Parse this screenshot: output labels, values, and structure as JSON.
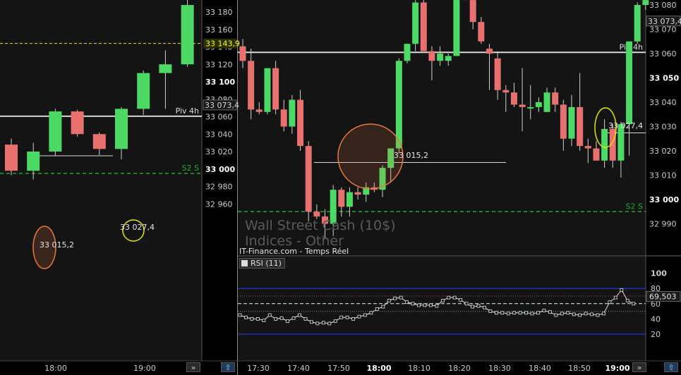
{
  "chart_data": [
    {
      "type": "candlestick",
      "ylim": [
        32950,
        33190
      ],
      "y_ticks": [
        "33 180",
        "33 160",
        "33 140",
        "33 120",
        "33 100",
        "33 080",
        "33 060",
        "33 040",
        "33 020",
        "33 000",
        "32 980",
        "32 960"
      ],
      "y_ticks_bold": [
        "33 100",
        "33 000"
      ],
      "x_ticks": [
        "18:00",
        "19:00"
      ],
      "candles": [
        {
          "o": 33028,
          "h": 33035,
          "l": 32993,
          "c": 32998
        },
        {
          "o": 32998,
          "h": 33030,
          "l": 32988,
          "c": 33020
        },
        {
          "o": 33020,
          "h": 33069,
          "l": 33015,
          "c": 33066
        },
        {
          "o": 33066,
          "h": 33068,
          "l": 33037,
          "c": 33040
        },
        {
          "o": 33040,
          "h": 33042,
          "l": 33016,
          "c": 33023
        },
        {
          "o": 33023,
          "h": 33071,
          "l": 33011,
          "c": 33069
        },
        {
          "o": 33069,
          "h": 33113,
          "l": 33062,
          "c": 33110
        },
        {
          "o": 33110,
          "h": 33136,
          "l": 33069,
          "c": 33120
        },
        {
          "o": 33120,
          "h": 33198,
          "l": 33117,
          "c": 33188
        }
      ],
      "levels": [
        {
          "label": "Piv 4h",
          "value": 33060.5,
          "color": "#d8d8d8",
          "style": "solid"
        },
        {
          "label": "",
          "value": 33143.9,
          "color": "#e6e600",
          "style": "dash"
        },
        {
          "label": "S2 S",
          "value": 32995,
          "color": "#1faa2f",
          "style": "dash"
        },
        {
          "label": "33 015,2",
          "value": 33015.2,
          "color": "#d8d8d8",
          "style": "solid"
        }
      ],
      "price_tags": [
        {
          "text": "33 143,9",
          "color": "#ffff00",
          "bg": "#2b2b00"
        },
        {
          "text": "33 073,4",
          "color": "#d8d8d8",
          "bg": "#1a1a1a"
        }
      ],
      "annotations": [
        {
          "text": "33 015,2",
          "color": "#e6e6e6"
        },
        {
          "text": "33 027,4",
          "color": "#e6e6e6"
        }
      ]
    },
    {
      "type": "candlestick",
      "ylim": [
        32978,
        33086
      ],
      "y_ticks": [
        "33 080",
        "33 070",
        "33 060",
        "33 050",
        "33 040",
        "33 030",
        "33 020",
        "33 010",
        "33 000",
        "32 990"
      ],
      "y_ticks_bold": [
        "33 050",
        "33 000"
      ],
      "x_ticks": [
        "17:30",
        "17:40",
        "17:50",
        "18:00",
        "18:10",
        "18:20",
        "18:30",
        "18:40",
        "18:50",
        "19:00"
      ],
      "x_ticks_bold": [
        "18:00",
        "19:00"
      ],
      "candles": [
        {
          "o": 33063,
          "h": 33066,
          "l": 33054,
          "c": 33057
        },
        {
          "o": 33057,
          "h": 33062,
          "l": 33033,
          "c": 33037
        },
        {
          "o": 33037,
          "h": 33040,
          "l": 33035,
          "c": 33036
        },
        {
          "o": 33036,
          "h": 33054,
          "l": 33035,
          "c": 33054
        },
        {
          "o": 33054,
          "h": 33057,
          "l": 33035,
          "c": 33037
        },
        {
          "o": 33037,
          "h": 33041,
          "l": 33028,
          "c": 33030
        },
        {
          "o": 33030,
          "h": 33043,
          "l": 33027,
          "c": 33041
        },
        {
          "o": 33041,
          "h": 33045,
          "l": 33020,
          "c": 33022
        },
        {
          "o": 33022,
          "h": 33024,
          "l": 32991,
          "c": 32995
        },
        {
          "o": 32995,
          "h": 32998,
          "l": 32992,
          "c": 32993
        },
        {
          "o": 32993,
          "h": 32996,
          "l": 32984,
          "c": 32990
        },
        {
          "o": 32990,
          "h": 33006,
          "l": 32985,
          "c": 33004
        },
        {
          "o": 33004,
          "h": 33005,
          "l": 32993,
          "c": 32997
        },
        {
          "o": 32997,
          "h": 33005,
          "l": 32993,
          "c": 33003
        },
        {
          "o": 33003,
          "h": 33005,
          "l": 33000,
          "c": 33002
        },
        {
          "o": 33002,
          "h": 33007,
          "l": 32999,
          "c": 33005
        },
        {
          "o": 33005,
          "h": 33007,
          "l": 33003,
          "c": 33004
        },
        {
          "o": 33004,
          "h": 33014,
          "l": 33001,
          "c": 33013
        },
        {
          "o": 33013,
          "h": 33019,
          "l": 33007,
          "c": 33021
        },
        {
          "o": 33021,
          "h": 33058,
          "l": 33019,
          "c": 33057
        },
        {
          "o": 33057,
          "h": 33064,
          "l": 33056,
          "c": 33064
        },
        {
          "o": 33064,
          "h": 33082,
          "l": 33061,
          "c": 33081
        },
        {
          "o": 33081,
          "h": 33086,
          "l": 33061,
          "c": 33061
        },
        {
          "o": 33061,
          "h": 33063,
          "l": 33049,
          "c": 33057
        },
        {
          "o": 33057,
          "h": 33063,
          "l": 33055,
          "c": 33060
        },
        {
          "o": 33057,
          "h": 33060,
          "l": 33055,
          "c": 33059
        },
        {
          "o": 33059,
          "h": 33086,
          "l": 33059,
          "c": 33086
        },
        {
          "o": 33086,
          "h": 33088,
          "l": 33082,
          "c": 33082
        },
        {
          "o": 33082,
          "h": 33087,
          "l": 33070,
          "c": 33073
        },
        {
          "o": 33073,
          "h": 33075,
          "l": 33064,
          "c": 33065
        },
        {
          "o": 33062,
          "h": 33064,
          "l": 33045,
          "c": 33060
        },
        {
          "o": 33058,
          "h": 33061,
          "l": 33041,
          "c": 33045
        },
        {
          "o": 33045,
          "h": 33047,
          "l": 33036,
          "c": 33044
        },
        {
          "o": 33044,
          "h": 33048,
          "l": 33038,
          "c": 33039
        },
        {
          "o": 33039,
          "h": 33054,
          "l": 33028,
          "c": 33038
        },
        {
          "o": 33038,
          "h": 33047,
          "l": 33033,
          "c": 33038
        },
        {
          "o": 33038,
          "h": 33042,
          "l": 33036,
          "c": 33040
        },
        {
          "o": 33036,
          "h": 33046,
          "l": 33036,
          "c": 33044
        },
        {
          "o": 33044,
          "h": 33046,
          "l": 33036,
          "c": 33039
        },
        {
          "o": 33039,
          "h": 33041,
          "l": 33020,
          "c": 33025
        },
        {
          "o": 33025,
          "h": 33043,
          "l": 33022,
          "c": 33038
        },
        {
          "o": 33038,
          "h": 33052,
          "l": 33020,
          "c": 33022
        },
        {
          "o": 33022,
          "h": 33025,
          "l": 33015,
          "c": 33021
        },
        {
          "o": 33021,
          "h": 33024,
          "l": 33016,
          "c": 33016
        },
        {
          "o": 33016,
          "h": 33033,
          "l": 33013,
          "c": 33029
        },
        {
          "o": 33029,
          "h": 33031,
          "l": 33013,
          "c": 33016
        },
        {
          "o": 33016,
          "h": 33032,
          "l": 33009,
          "c": 33031
        },
        {
          "o": 33031,
          "h": 33065,
          "l": 33018,
          "c": 33065
        },
        {
          "o": 33065,
          "h": 33081,
          "l": 33064,
          "c": 33080
        },
        {
          "o": 33080,
          "h": 33083,
          "l": 33078,
          "c": 33082
        }
      ],
      "levels": [
        {
          "label": "Piv 4h",
          "value": 33060.5,
          "color": "#d8d8d8",
          "style": "solid"
        },
        {
          "label": "S2 S",
          "value": 32995,
          "color": "#1faa2f",
          "style": "dash"
        },
        {
          "label": "33 015,2",
          "value": 33015.2,
          "color": "#d8d8d8",
          "style": "solid"
        },
        {
          "label": "33 027,4",
          "value": 33027.4,
          "color": "#d8d8d8",
          "style": "solid"
        }
      ],
      "price_tags": [
        {
          "text": "33 073,4",
          "color": "#d8d8d8",
          "bg": "#1a1a1a"
        }
      ],
      "watermark": [
        "Wall Street Cash (10$)",
        "Indices - Other"
      ],
      "source": "IT-Finance.com - Temps Réel"
    },
    {
      "type": "line",
      "title": "RSI (11)",
      "ylim": [
        10,
        100
      ],
      "y_ticks": [
        "100",
        "80",
        "60",
        "40",
        "20"
      ],
      "reference_lines": [
        {
          "value": 80,
          "color": "#2a3bff"
        },
        {
          "value": 70,
          "color": "#c0392b"
        },
        {
          "value": 60,
          "color": "#eeeeee"
        },
        {
          "value": 50,
          "color": "#55aa55"
        },
        {
          "value": 20,
          "color": "#2a3bff"
        }
      ],
      "last_value": "69,503",
      "values": [
        45,
        42,
        40,
        40,
        38,
        45,
        40,
        41,
        37,
        41,
        45,
        40,
        36,
        34,
        35,
        34,
        37,
        42,
        42,
        40,
        43,
        45,
        48,
        53,
        56,
        64,
        67,
        68,
        62,
        60,
        58,
        58,
        58,
        57,
        64,
        68,
        68,
        65,
        60,
        56,
        57,
        55,
        50,
        48,
        48,
        47,
        48,
        48,
        48,
        47,
        48,
        51,
        49,
        45,
        47,
        48,
        46,
        45,
        47,
        46,
        45,
        47,
        62,
        68,
        78,
        64,
        60
      ]
    }
  ]
}
